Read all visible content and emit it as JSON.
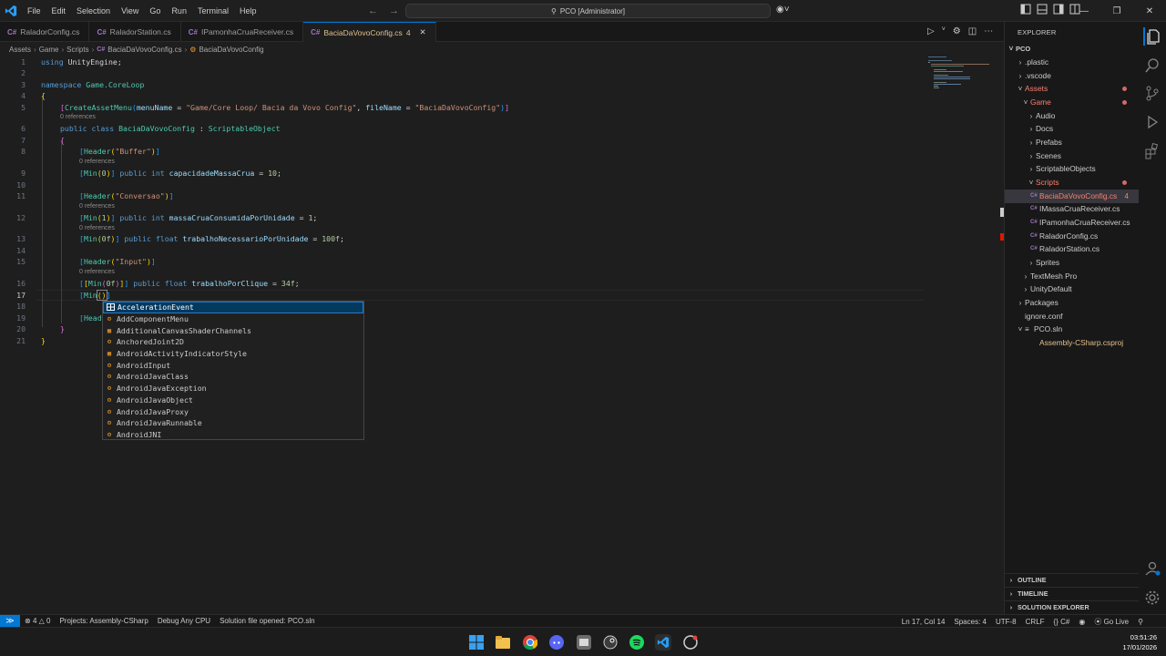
{
  "window": {
    "title": "PCO [Administrator]",
    "menu": [
      "File",
      "Edit",
      "Selection",
      "View",
      "Go",
      "Run",
      "Terminal",
      "Help"
    ]
  },
  "tabs": [
    {
      "label": "RaladorConfig.cs",
      "active": false
    },
    {
      "label": "RaladorStation.cs",
      "active": false
    },
    {
      "label": "IPamonhaCruaReceiver.cs",
      "active": false
    },
    {
      "label": "BaciaDaVovoConfig.cs",
      "badge": "4",
      "active": true
    }
  ],
  "breadcrumbs": [
    "Assets",
    "Game",
    "Scripts",
    "BaciaDaVovoConfig.cs",
    "BaciaDaVovoConfig"
  ],
  "editor": {
    "line_numbers": [
      "1",
      "2",
      "3",
      "4",
      "5",
      "6",
      "7",
      "8",
      "9",
      "10",
      "11",
      "12",
      "13",
      "14",
      "15",
      "16",
      "17",
      "18",
      "19",
      "20",
      "21"
    ],
    "lens": "0 references",
    "lines": {
      "l1a": "using ",
      "l1b": "UnityEngine",
      "l1c": ";",
      "l3a": "namespace ",
      "l3b": "Game.CoreLoop",
      "l4": "{",
      "l5a": "[",
      "l5b": "CreateAssetMenu",
      "l5c": "(",
      "l5d": "menuName",
      "l5e": " = ",
      "l5f": "\"Game/Core Loop/ Bacia da Vovo Config\"",
      "l5g": ", ",
      "l5h": "fileName",
      "l5i": " = ",
      "l5j": "\"BaciaDaVovoConfig\"",
      "l5k": ")",
      "l5l": "]",
      "l6a": "public class ",
      "l6b": "BaciaDaVovoConfig",
      "l6c": " : ",
      "l6d": "ScriptableObject",
      "l7": "{",
      "l8a": "[",
      "l8b": "Header",
      "l8c": "(",
      "l8d": "\"Buffer\"",
      "l8e": ")",
      "l8f": "]",
      "l9a": "[",
      "l9b": "Min",
      "l9c": "(",
      "l9d": "0",
      "l9e": ")",
      "l9f": "]",
      "l9g": " public int ",
      "l9h": "capacidadeMassaCrua",
      "l9i": " = ",
      "l9j": "10",
      "l9k": ";",
      "l11a": "[",
      "l11b": "Header",
      "l11c": "(",
      "l11d": "\"Conversao\"",
      "l11e": ")",
      "l11f": "]",
      "l12a": "[",
      "l12b": "Min",
      "l12c": "(",
      "l12d": "1",
      "l12e": ")",
      "l12f": "]",
      "l12g": " public int ",
      "l12h": "massaCruaConsumidaPorUnidade",
      "l12i": " = ",
      "l12j": "1",
      "l12k": ";",
      "l13a": "[",
      "l13b": "Min",
      "l13c": "(",
      "l13d": "0f",
      "l13e": ")",
      "l13f": "]",
      "l13g": " public float ",
      "l13h": "trabalhoNecessarioPorUnidade",
      "l13i": " = ",
      "l13j": "100f",
      "l13k": ";",
      "l15a": "[",
      "l15b": "Header",
      "l15c": "(",
      "l15d": "\"Input\"",
      "l15e": ")",
      "l15f": "]",
      "l16a": "[",
      "l16b": "[",
      "l16c": "Min",
      "l16d": "(",
      "l16e": "0f",
      "l16f": ")",
      "l16g": "]",
      "l16h": "]",
      "l16i": " public float ",
      "l16j": "trabalhoPorClique",
      "l16k": " = ",
      "l16l": "34f",
      "l16m": ";",
      "l17a": "[",
      "l17b": "Min",
      "l17c": "()",
      "l17d": "]",
      "l19a": "[",
      "l19b": "Head",
      "l20": "}",
      "l21": "}"
    }
  },
  "suggestions": [
    {
      "label": "AccelerationEvent",
      "kind": "struct"
    },
    {
      "label": "AddComponentMenu",
      "kind": "class"
    },
    {
      "label": "AdditionalCanvasShaderChannels",
      "kind": "enum"
    },
    {
      "label": "AnchoredJoint2D",
      "kind": "class"
    },
    {
      "label": "AndroidActivityIndicatorStyle",
      "kind": "enum"
    },
    {
      "label": "AndroidInput",
      "kind": "class"
    },
    {
      "label": "AndroidJavaClass",
      "kind": "class"
    },
    {
      "label": "AndroidJavaException",
      "kind": "class"
    },
    {
      "label": "AndroidJavaObject",
      "kind": "class"
    },
    {
      "label": "AndroidJavaProxy",
      "kind": "class"
    },
    {
      "label": "AndroidJavaRunnable",
      "kind": "class"
    },
    {
      "label": "AndroidJNI",
      "kind": "class"
    }
  ],
  "explorer": {
    "title": "EXPLORER",
    "root": "PCO",
    "items": [
      {
        "label": ".plastic"
      },
      {
        "label": ".vscode"
      },
      {
        "label": "Assets"
      },
      {
        "label": "Game"
      },
      {
        "label": "Audio"
      },
      {
        "label": "Docs"
      },
      {
        "label": "Prefabs"
      },
      {
        "label": "Scenes"
      },
      {
        "label": "ScriptableObjects"
      },
      {
        "label": "Scripts"
      },
      {
        "label": "BaciaDaVovoConfig.cs",
        "badge": "4"
      },
      {
        "label": "IMassaCruaReceiver.cs"
      },
      {
        "label": "IPamonhaCruaReceiver.cs"
      },
      {
        "label": "RaladorConfig.cs"
      },
      {
        "label": "RaladorStation.cs"
      },
      {
        "label": "Sprites"
      },
      {
        "label": "TextMesh Pro"
      },
      {
        "label": "UnityDefault"
      },
      {
        "label": "Packages"
      },
      {
        "label": "ignore.conf"
      },
      {
        "label": "PCO.sln"
      },
      {
        "label": "Assembly-CSharp.csproj"
      }
    ],
    "sections": [
      "OUTLINE",
      "TIMELINE",
      "SOLUTION EXPLORER"
    ]
  },
  "status": {
    "errors": "4",
    "warnings": "0",
    "projects": "Projects: Assembly-CSharp",
    "debug": "Debug Any CPU",
    "solution": "Solution file opened: PCO.sln",
    "position": "Ln 17, Col 14",
    "spaces": "Spaces: 4",
    "encoding": "UTF-8",
    "eol": "CRLF",
    "language": "C#",
    "golive": "Go Live"
  },
  "clock": {
    "time": "03:51:26",
    "date": "17/01/2026"
  },
  "colors": {
    "accent": "#0078d4",
    "modified": "#e2c08d",
    "error": "#f88070"
  }
}
